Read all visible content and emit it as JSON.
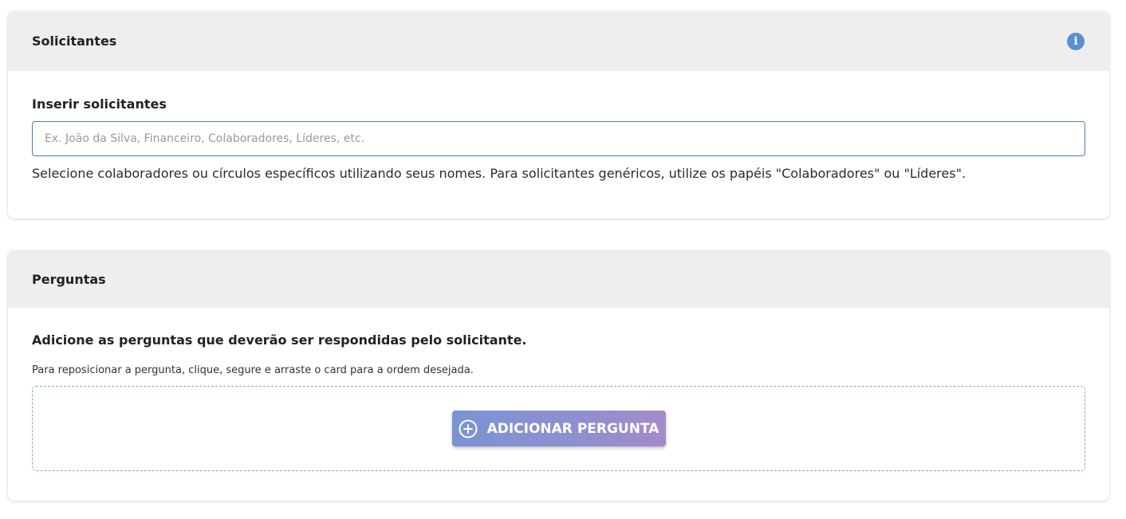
{
  "solicitantes": {
    "title": "Solicitantes",
    "info_icon": "info-icon",
    "field_label": "Inserir solicitantes",
    "input_placeholder": "Ex. João da Silva, Financeiro, Colaboradores, Líderes, etc.",
    "input_value": "",
    "help_text": "Selecione colaboradores ou círculos específicos utilizando seus nomes. Para solicitantes genéricos, utilize os papéis \"Colaboradores\" ou \"Líderes\"."
  },
  "perguntas": {
    "title": "Perguntas",
    "heading": "Adicione as perguntas que deverão ser respondidas pelo solicitante.",
    "hint": "Para reposicionar a pergunta, clique, segure e arraste o card para a ordem desejada.",
    "add_button_label": "ADICIONAR PERGUNTA",
    "add_button_icon": "plus-circle-icon"
  },
  "colors": {
    "info_icon": "#5b8fd0",
    "header_bg": "#eeeeee",
    "input_border": "#4a7fb5",
    "button_gradient_start": "#7b93d2",
    "button_gradient_end": "#a58ac9",
    "dropzone_border": "#7aa8c9"
  }
}
